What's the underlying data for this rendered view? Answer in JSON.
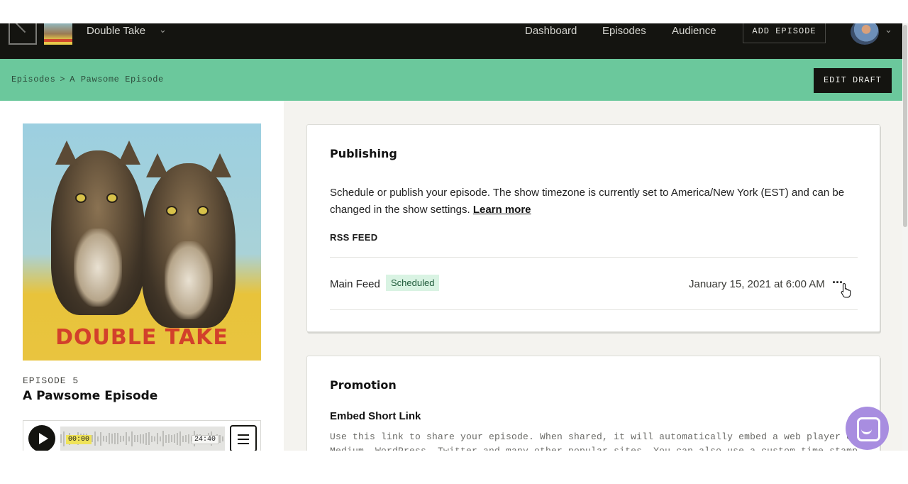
{
  "nav": {
    "show_name": "Double Take",
    "links": [
      "Dashboard",
      "Episodes",
      "Audience"
    ],
    "add_episode": "ADD EPISODE"
  },
  "breadcrumb": {
    "parent": "Episodes",
    "separator": ">",
    "current": "A Pawsome Episode",
    "edit_draft": "EDIT DRAFT"
  },
  "episode": {
    "cover_title": "DOUBLE TAKE",
    "label": "EPISODE 5",
    "title": "A Pawsome Episode",
    "player": {
      "current_time": "00:00",
      "total_time": "24:40"
    }
  },
  "publishing": {
    "heading": "Publishing",
    "description": "Schedule or publish your episode. The show timezone is currently set to America/New York (EST) and can be changed in the show settings.",
    "learn_more": "Learn more",
    "rss_label": "RSS FEED",
    "feed": {
      "name": "Main Feed",
      "status": "Scheduled",
      "date": "January 15, 2021 at 6:00 AM",
      "menu": "···"
    }
  },
  "promotion": {
    "heading": "Promotion",
    "embed_heading": "Embed Short Link",
    "embed_desc": "Use this link to share your episode. When shared, it will automatically embed a web player on Medium, WordPress, Twitter and many other popular sites. You can also use a custom time stamp to"
  },
  "colors": {
    "nav_bg": "#141410",
    "breadcrumb_bg": "#6bc89c",
    "badge_bg": "#d9f3e3",
    "chat_bubble": "#a88de0"
  },
  "icons": [
    "chevron-down-icon",
    "play-icon",
    "menu-icon",
    "more-icon",
    "chat-icon"
  ]
}
